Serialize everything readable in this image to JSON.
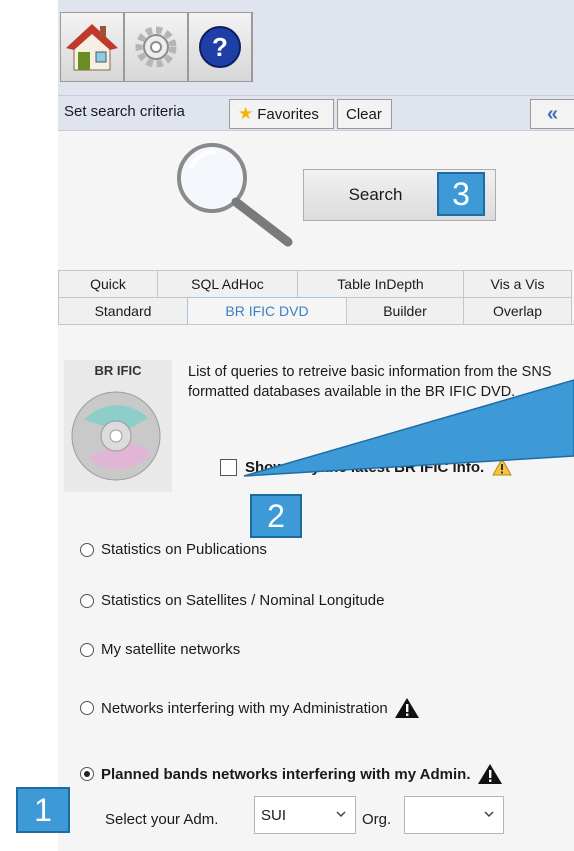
{
  "toolbar": {
    "buttons": [
      {
        "name": "home-icon"
      },
      {
        "name": "gear-icon"
      },
      {
        "name": "help-icon",
        "glyph": "?"
      }
    ]
  },
  "criteria": {
    "label": "Set search criteria",
    "favorites": "Favorites",
    "clear": "Clear",
    "collapse": "«"
  },
  "search": {
    "label": "Search"
  },
  "tabs": {
    "row1": [
      "Quick",
      "SQL AdHoc",
      "Table InDepth",
      "Vis a Vis"
    ],
    "row2": [
      "Standard",
      "BR IFIC DVD",
      "Builder",
      "Overlap"
    ],
    "active": "BR IFIC DVD"
  },
  "bific": {
    "icon_label": "BR IFIC",
    "description": "List of queries to retreive basic information from the SNS formatted databases available in the BR IFIC DVD.",
    "latest_checkbox": "Show only the latest BR IFIC info."
  },
  "queries": [
    {
      "label": "Statistics on Publications",
      "checked": false
    },
    {
      "label": "Statistics on Satellites / Nominal Longitude",
      "checked": false
    },
    {
      "label": "My satellite networks",
      "checked": false
    },
    {
      "label": "Networks interfering with my Administration",
      "checked": false
    },
    {
      "label": "Planned bands networks interfering with my Admin.",
      "checked": true
    }
  ],
  "admin": {
    "label": "Select your Adm.",
    "adm_value": "SUI",
    "org_label": "Org.",
    "org_value": ""
  },
  "callouts": [
    "1",
    "2",
    "3"
  ],
  "colors": {
    "accent": "#3e9ad7",
    "toolbar_bg": "#dfe4ee",
    "active_tab": "#3b7fc4"
  }
}
